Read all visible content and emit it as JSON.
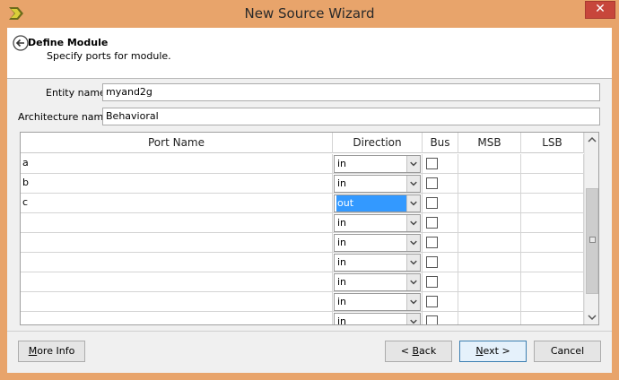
{
  "window": {
    "title": "New Source Wizard",
    "close_glyph": "✕"
  },
  "header": {
    "title": "Define Module",
    "subtitle": "Specify ports for module."
  },
  "form": {
    "entity_label": "Entity name",
    "entity_value": "myand2g",
    "arch_label": "Architecture name",
    "arch_value": "Behavioral"
  },
  "grid": {
    "columns": [
      "Port Name",
      "Direction",
      "Bus",
      "MSB",
      "LSB"
    ],
    "rows": [
      {
        "name": "a",
        "direction": "in",
        "bus": false,
        "msb": "",
        "lsb": ""
      },
      {
        "name": "b",
        "direction": "in",
        "bus": false,
        "msb": "",
        "lsb": ""
      },
      {
        "name": "c",
        "direction": "out",
        "bus": false,
        "msb": "",
        "lsb": "",
        "selected": true
      },
      {
        "name": "",
        "direction": "in",
        "bus": false,
        "msb": "",
        "lsb": ""
      },
      {
        "name": "",
        "direction": "in",
        "bus": false,
        "msb": "",
        "lsb": ""
      },
      {
        "name": "",
        "direction": "in",
        "bus": false,
        "msb": "",
        "lsb": ""
      },
      {
        "name": "",
        "direction": "in",
        "bus": false,
        "msb": "",
        "lsb": ""
      },
      {
        "name": "",
        "direction": "in",
        "bus": false,
        "msb": "",
        "lsb": ""
      },
      {
        "name": "",
        "direction": "in",
        "bus": false,
        "msb": "",
        "lsb": ""
      }
    ]
  },
  "buttons": {
    "more_info": {
      "pre": "",
      "mnemonic": "M",
      "post": "ore Info"
    },
    "back": {
      "pre": "< ",
      "mnemonic": "B",
      "post": "ack"
    },
    "next": {
      "pre": "",
      "mnemonic": "N",
      "post": "ext >"
    },
    "cancel": {
      "pre": "",
      "mnemonic": "",
      "post": "Cancel"
    }
  },
  "colors": {
    "titlebar": "#e8a46b",
    "selection": "#3399ff",
    "close": "#c7463b"
  }
}
